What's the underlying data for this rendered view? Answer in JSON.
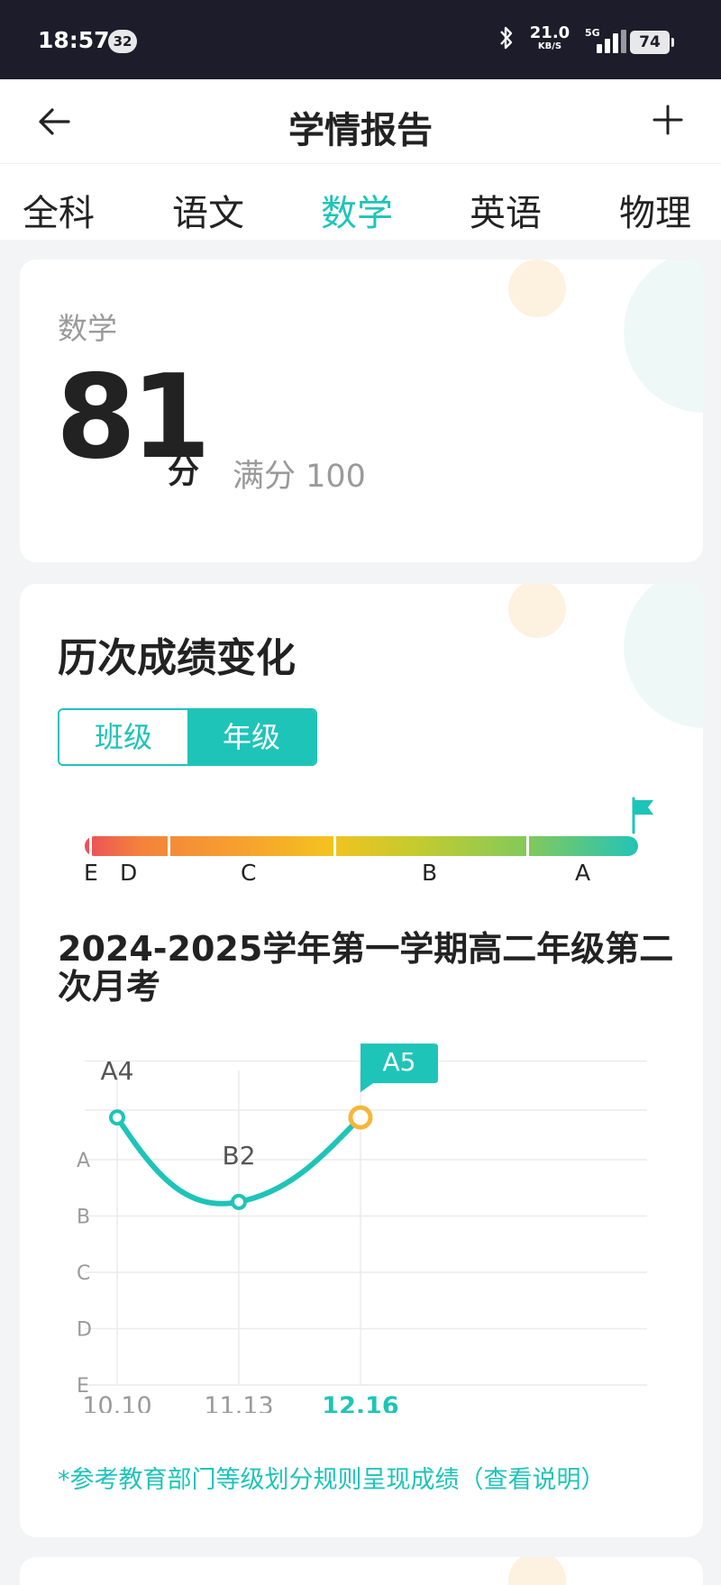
{
  "status_bar": {
    "time": "18:57",
    "notification_count": "32",
    "net_speed": "21.0",
    "net_speed_unit": "KB/S",
    "network": "5G",
    "battery": "74"
  },
  "header": {
    "title": "学情报告",
    "back_icon": "arrow-left-icon",
    "add_icon": "plus-icon"
  },
  "tabs": [
    {
      "label": "全科",
      "active": false
    },
    {
      "label": "语文",
      "active": false
    },
    {
      "label": "数学",
      "active": true
    },
    {
      "label": "英语",
      "active": false
    },
    {
      "label": "物理",
      "active": false
    }
  ],
  "score_card": {
    "subject": "数学",
    "score": "81",
    "unit": "分",
    "full_score": "满分 100"
  },
  "history": {
    "title": "历次成绩变化",
    "toggle": {
      "left": "班级",
      "right": "年级",
      "selected": "年级"
    },
    "grade_scale": [
      "E",
      "D",
      "C",
      "B",
      "A"
    ],
    "flag_icon": "flag-icon",
    "exam_title": "2024-2025学年第一学期高二年级第二次月考",
    "footnote": "*参考教育部门等级划分规则呈现成绩（查看说明）"
  },
  "colors": {
    "accent": "#1ec4b8",
    "highlight_point": "#f6b638",
    "text_dark": "#222222",
    "text_gray": "#9a9a9a"
  },
  "chart_data": {
    "type": "line",
    "x": [
      "10.10",
      "11.13",
      "12.16"
    ],
    "highlight_x": "12.16",
    "y_categories": [
      "E",
      "D",
      "C",
      "B",
      "A"
    ],
    "points": [
      {
        "x": "10.10",
        "label": "A4",
        "level": 5.75
      },
      {
        "x": "11.13",
        "label": "B2",
        "level": 4.25
      },
      {
        "x": "12.16",
        "label": "A5",
        "level": 5.75
      }
    ],
    "grid": true
  }
}
